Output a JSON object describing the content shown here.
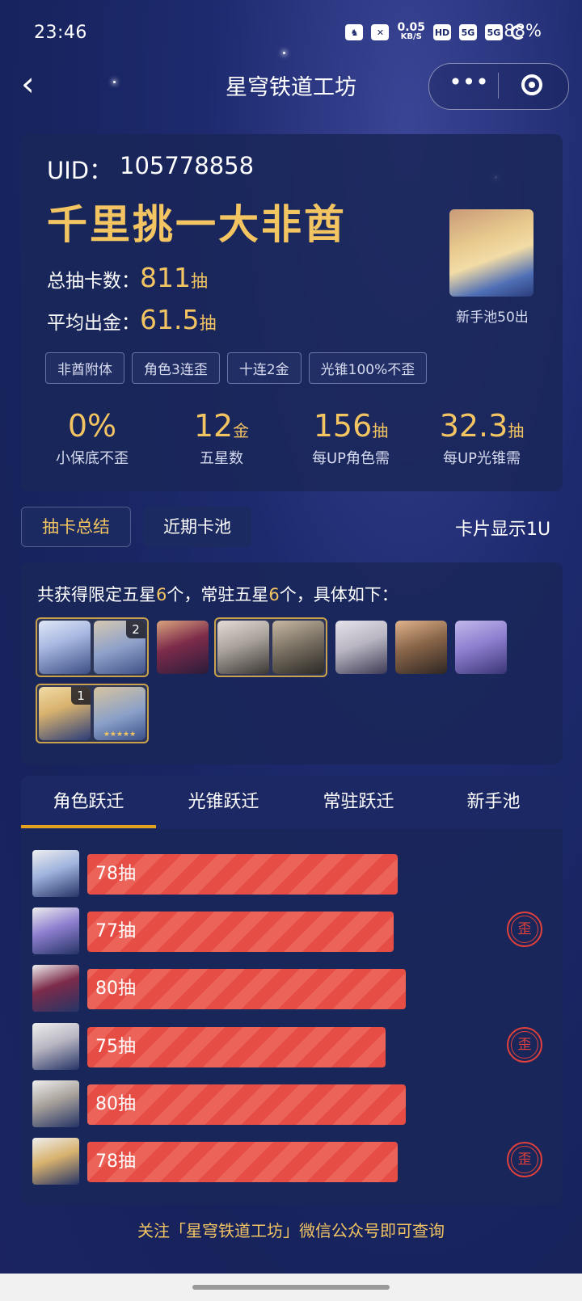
{
  "status": {
    "time": "23:46",
    "net_speed": "0.05",
    "net_unit": "KB/S",
    "battery": "88%"
  },
  "nav": {
    "back": "‹",
    "title": "星穹铁道工坊",
    "more": "•••"
  },
  "profile": {
    "uid_label": "UID：",
    "uid": "105778858",
    "rank_title": "千里挑一大非酋",
    "total_label": "总抽卡数：",
    "total_value": "811",
    "total_unit": "抽",
    "avg_label": "平均出金：",
    "avg_value": "61.5",
    "avg_unit": "抽",
    "avatar_caption": "新手池50出",
    "tags": [
      "非酋附体",
      "角色3连歪",
      "十连2金",
      "光锥100%不歪"
    ]
  },
  "stats": [
    {
      "value": "0%",
      "unit": "",
      "label": "小保底不歪"
    },
    {
      "value": "12",
      "unit": "金",
      "label": "五星数"
    },
    {
      "value": "156",
      "unit": "抽",
      "label": "每UP角色需"
    },
    {
      "value": "32.3",
      "unit": "抽",
      "label": "每UP光锥需"
    }
  ],
  "tabs": {
    "summary": "抽卡总结",
    "recent": "近期卡池",
    "card_display": "卡片显示1U"
  },
  "five_star": {
    "desc_a": "共获得限定五星",
    "limited": "6",
    "desc_b": "个，常驻五星",
    "standard": "6",
    "desc_c": "个，具体如下：",
    "badges": {
      "a": "2",
      "b": "1"
    }
  },
  "jump_tabs": [
    "角色跃迁",
    "光锥跃迁",
    "常驻跃迁",
    "新手池"
  ],
  "pulls": [
    {
      "label": "78抽",
      "value": 78,
      "off": false,
      "hue": "#9fb3de"
    },
    {
      "label": "77抽",
      "value": 77,
      "off": true,
      "hue": "#8f7fd0"
    },
    {
      "label": "80抽",
      "value": 80,
      "off": false,
      "hue": "#7d2b4a"
    },
    {
      "label": "75抽",
      "value": 75,
      "off": true,
      "hue": "#b9b6c2"
    },
    {
      "label": "80抽",
      "value": 80,
      "off": false,
      "hue": "#a9a29b"
    },
    {
      "label": "78抽",
      "value": 78,
      "off": true,
      "hue": "#d8b26e"
    }
  ],
  "off_label": "歪",
  "footer": "关注「星穹铁道工坊」微信公众号即可查询"
}
